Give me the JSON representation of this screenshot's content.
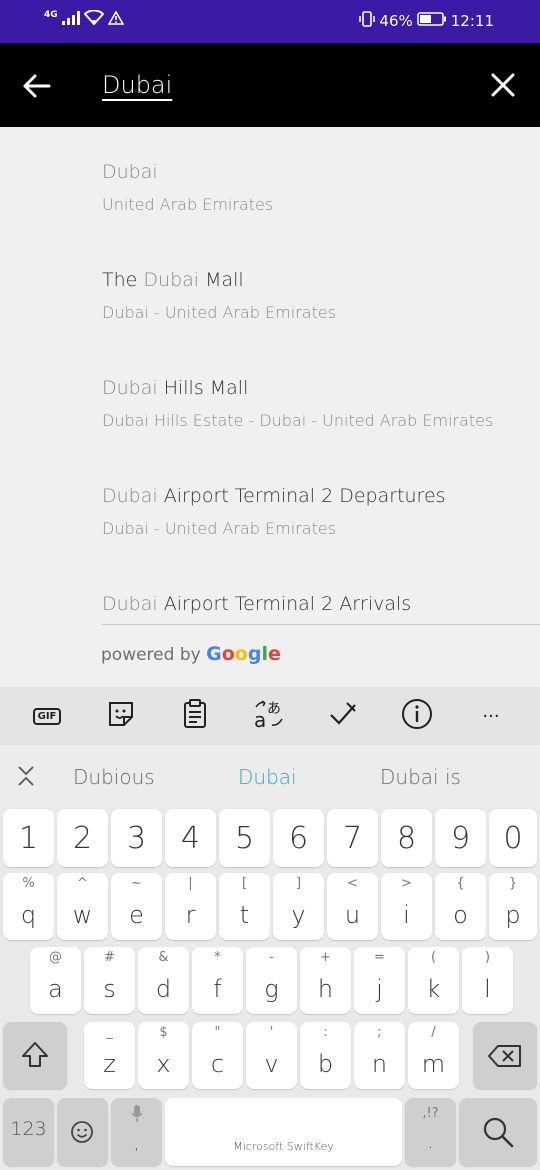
{
  "status_bar": {
    "network": "4G",
    "battery": "46%",
    "time": "12:11"
  },
  "search": {
    "query": "Dubai"
  },
  "results": [
    {
      "title_highlight_before": "",
      "title_prefix": "",
      "title_highlight": "Dubai",
      "title_rest": "",
      "subtitle": "United Arab Emirates"
    },
    {
      "title_prefix": "The ",
      "title_highlight": "Dubai",
      "title_rest": " Mall",
      "subtitle": "Dubai - United Arab Emirates"
    },
    {
      "title_prefix": "",
      "title_highlight": "Dubai",
      "title_rest": " Hills Mall",
      "subtitle": "Dubai Hills Estate - Dubai - United Arab Emirates"
    },
    {
      "title_prefix": "",
      "title_highlight": "Dubai",
      "title_rest": " Airport Terminal 2 Departures",
      "subtitle": "Dubai - United Arab Emirates"
    },
    {
      "title_prefix": "",
      "title_highlight": "Dubai",
      "title_rest": " Airport Terminal 2 Arrivals",
      "subtitle": ""
    }
  ],
  "powered_by": {
    "prefix": "powered by ",
    "brand": [
      "G",
      "o",
      "o",
      "g",
      "l",
      "e"
    ],
    "brand_colors": [
      "#4285F4",
      "#EA4335",
      "#FBBC05",
      "#4285F4",
      "#34A853",
      "#EA4335"
    ]
  },
  "keyboard_toolbar": {
    "gif_label": "GIF",
    "more_label": "···"
  },
  "suggestions": [
    "Dubious",
    "Dubai",
    "Dubai is"
  ],
  "keyboard": {
    "number_row": [
      "1",
      "2",
      "3",
      "4",
      "5",
      "6",
      "7",
      "8",
      "9",
      "0"
    ],
    "row1": [
      {
        "m": "q",
        "s": "%"
      },
      {
        "m": "w",
        "s": "^"
      },
      {
        "m": "e",
        "s": "~"
      },
      {
        "m": "r",
        "s": "|"
      },
      {
        "m": "t",
        "s": "["
      },
      {
        "m": "y",
        "s": "]"
      },
      {
        "m": "u",
        "s": "<"
      },
      {
        "m": "i",
        "s": ">"
      },
      {
        "m": "o",
        "s": "{"
      },
      {
        "m": "p",
        "s": "}"
      }
    ],
    "row2": [
      {
        "m": "a",
        "s": "@"
      },
      {
        "m": "s",
        "s": "#"
      },
      {
        "m": "d",
        "s": "&"
      },
      {
        "m": "f",
        "s": "*"
      },
      {
        "m": "g",
        "s": "-"
      },
      {
        "m": "h",
        "s": "+"
      },
      {
        "m": "j",
        "s": "="
      },
      {
        "m": "k",
        "s": "("
      },
      {
        "m": "l",
        "s": ")"
      }
    ],
    "row3": [
      {
        "m": "z",
        "s": "_"
      },
      {
        "m": "x",
        "s": "$"
      },
      {
        "m": "c",
        "s": "\""
      },
      {
        "m": "v",
        "s": "'"
      },
      {
        "m": "b",
        "s": ":"
      },
      {
        "m": "n",
        "s": ";"
      },
      {
        "m": "m",
        "s": "/"
      }
    ],
    "numbers_key": "123",
    "comma_key": ",",
    "space_label": "Microsoft SwiftKey",
    "period_key": ".",
    "period_alt": ",!?"
  }
}
